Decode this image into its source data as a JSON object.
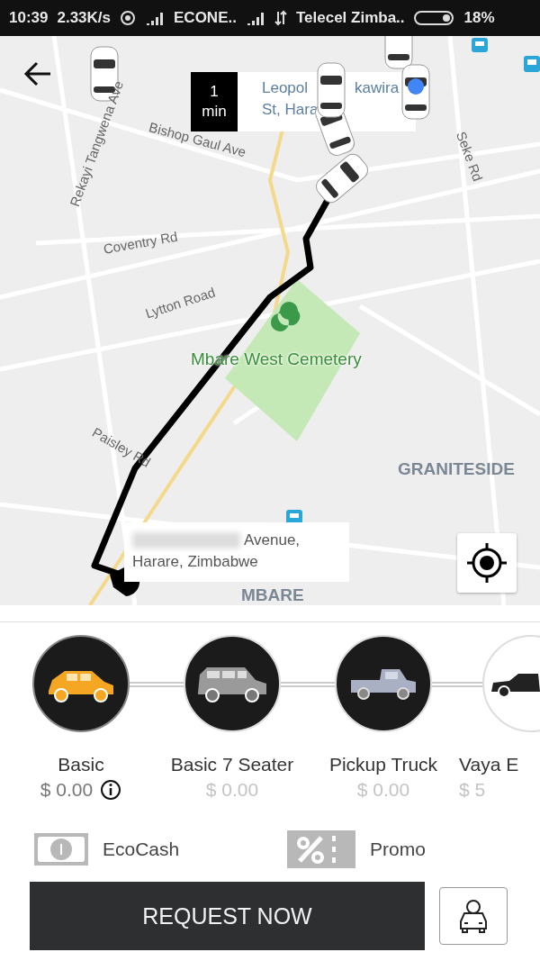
{
  "status_bar": {
    "time": "10:39",
    "speed": "2.33K/s",
    "carrier_1": "ECONE..",
    "carrier_2": "Telecel Zimba..",
    "battery": "18%"
  },
  "map": {
    "labels": [
      {
        "text": "Rekayi Tangwena Ave",
        "kind": "road"
      },
      {
        "text": "Bishop Gaul Ave",
        "kind": "road"
      },
      {
        "text": "Coventry Rd",
        "kind": "road"
      },
      {
        "text": "Lytton Road",
        "kind": "road"
      },
      {
        "text": "Mbare West Cemetery",
        "kind": "park"
      },
      {
        "text": "Paisley Rd",
        "kind": "road"
      },
      {
        "text": "Seke Rd",
        "kind": "road"
      },
      {
        "text": "GRANITESIDE",
        "kind": "area"
      },
      {
        "text": "MBARE",
        "kind": "area"
      }
    ],
    "pickup": {
      "eta_value": "1",
      "eta_unit": "min",
      "address_parts": [
        "Leopol",
        "kawira"
      ],
      "address_line_2": "St, Hara"
    },
    "dropoff": {
      "address_line_1": "Avenue,",
      "address_line_2": "Harare, Zimbabwe"
    }
  },
  "vehicles": [
    {
      "name": "Basic",
      "price": "$ 0.00",
      "selected": true,
      "kind": "hatchback"
    },
    {
      "name": "Basic 7 Seater",
      "price": "$ 0.00",
      "selected": false,
      "kind": "suv"
    },
    {
      "name": "Pickup Truck",
      "price": "$ 0.00",
      "selected": false,
      "kind": "pickup"
    },
    {
      "name": "Vaya E",
      "price": "$ 5",
      "selected": false,
      "kind": "sedan"
    }
  ],
  "payment": {
    "method": "EcoCash",
    "promo": "Promo"
  },
  "request_button": "REQUEST NOW"
}
